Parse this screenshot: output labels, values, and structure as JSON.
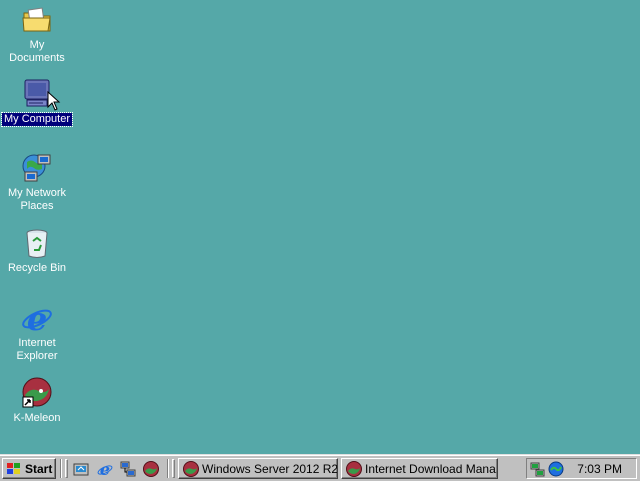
{
  "desktop": {
    "background": "#55a8a8",
    "icons": [
      {
        "label": "My Documents",
        "icon": "folder-documents-icon",
        "selected": false
      },
      {
        "label": "My Computer",
        "icon": "computer-icon",
        "selected": true
      },
      {
        "label": "My Network\nPlaces",
        "icon": "network-places-icon",
        "selected": false
      },
      {
        "label": "Recycle Bin",
        "icon": "recycle-bin-icon",
        "selected": false
      },
      {
        "label": "Internet\nExplorer",
        "icon": "internet-explorer-icon",
        "selected": false
      },
      {
        "label": "K-Meleon",
        "icon": "k-meleon-icon",
        "selected": false,
        "shortcut": true
      }
    ]
  },
  "taskbar": {
    "start_label": "Start",
    "quick_launch": [
      "show-desktop-icon",
      "internet-explorer-icon",
      "network-icon",
      "k-meleon-icon"
    ],
    "tasks": [
      {
        "label": "Windows Server 2012 R2 ...",
        "icon": "k-meleon-icon",
        "active": false
      },
      {
        "label": "Internet Download Mana...",
        "icon": "k-meleon-icon",
        "active": false
      }
    ],
    "tray": {
      "icons": [
        "network-connection-icon",
        "volume-icon"
      ],
      "clock": "7:03 PM"
    }
  }
}
